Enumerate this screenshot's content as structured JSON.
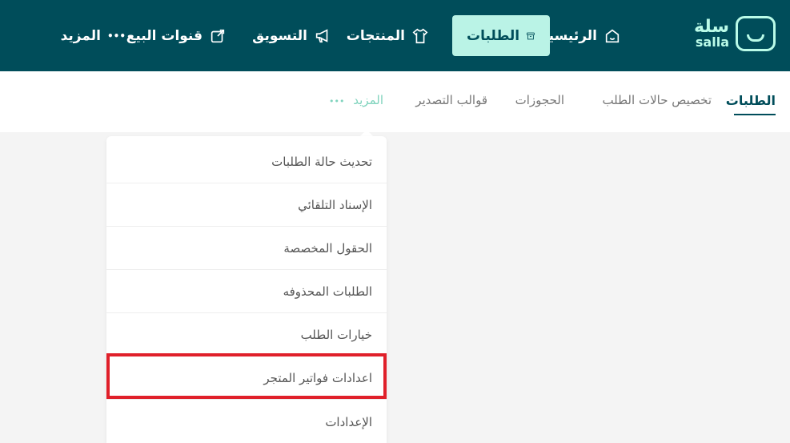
{
  "brand": {
    "name_ar": "سلة",
    "name_en": "salla"
  },
  "top_nav": {
    "home": "الرئيسية",
    "orders": "الطلبات",
    "products": "المنتجات",
    "marketing": "التسويق",
    "sales_channels": "قنوات البيع",
    "more": "المزيد",
    "more_dots": "•••"
  },
  "sub_nav": {
    "orders": "الطلبات",
    "status_custom": "تخصيص حالات الطلب",
    "bookings": "الحجوزات",
    "export_templates": "قوالب التصدير",
    "more": "المزيد",
    "more_dots": "•••"
  },
  "dropdown": {
    "items": [
      "تحديث حالة الطلبات",
      "الإسناد التلقائي",
      "الحقول المخصصة",
      "الطلبات المحذوفه",
      "خيارات الطلب",
      "اعدادات فواتير المتجر",
      "الإعدادات"
    ]
  },
  "colors": {
    "topbar": "#004d5a",
    "active_tab_bg": "#baf3e6",
    "accent": "#7fd3bd",
    "highlight": "#e0202a"
  }
}
